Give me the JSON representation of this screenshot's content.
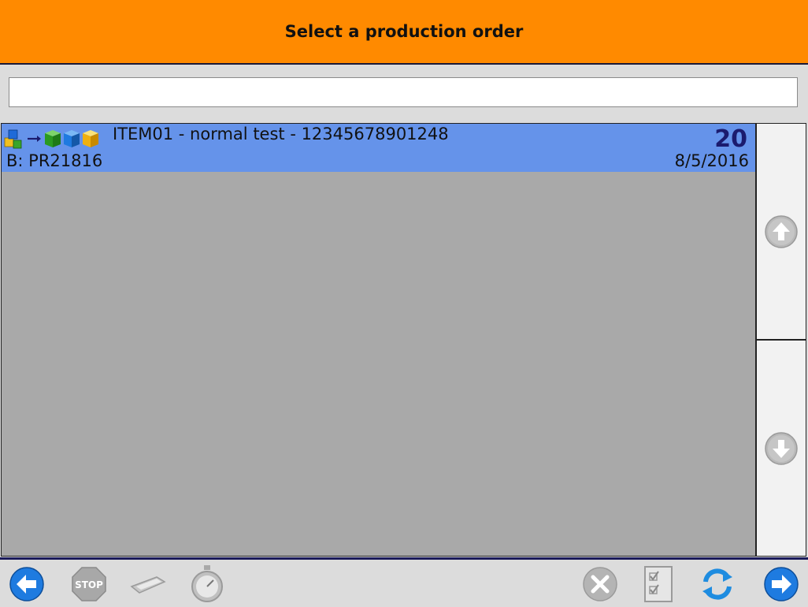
{
  "header": {
    "title": "Select a production order"
  },
  "search": {
    "value": "",
    "placeholder": ""
  },
  "orders": [
    {
      "item": "ITEM01 - normal test - 12345678901248",
      "batch": "B: PR21816",
      "quantity": "20",
      "date": "8/5/2016",
      "selected": true,
      "icons": [
        "cubes-icon",
        "arrow-icon",
        "green-cube-icon",
        "blue-cube-icon",
        "yellow-cube-icon"
      ]
    }
  ],
  "scrollbar": {
    "up_icon": "arrow-up-icon",
    "down_icon": "arrow-down-icon"
  },
  "footer": {
    "buttons": [
      {
        "name": "back-button",
        "icon": "arrow-left-icon",
        "enabled": true
      },
      {
        "name": "stop-button",
        "icon": "stop-sign-icon",
        "label": "STOP",
        "enabled": false
      },
      {
        "name": "scanner-button",
        "icon": "scanner-icon",
        "enabled": false
      },
      {
        "name": "timer-button",
        "icon": "stopwatch-icon",
        "enabled": false
      },
      {
        "name": "cancel-button",
        "icon": "x-circle-icon",
        "enabled": false
      },
      {
        "name": "checklist-button",
        "icon": "checklist-icon",
        "enabled": false
      },
      {
        "name": "refresh-button",
        "icon": "refresh-icon",
        "enabled": true
      },
      {
        "name": "next-button",
        "icon": "arrow-right-icon",
        "enabled": true
      }
    ]
  },
  "colors": {
    "header": "#ff8a00",
    "selected_row": "#6593ea",
    "list_bg": "#a9a9a9",
    "quantity": "#1b1b6e",
    "active_button": "#1e7be0",
    "disabled_button": "#a8a8a8"
  }
}
